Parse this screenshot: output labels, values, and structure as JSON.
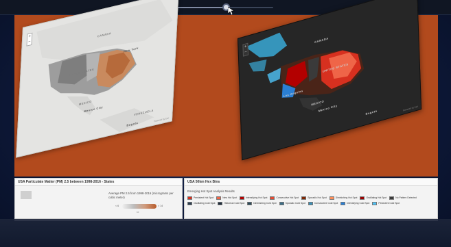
{
  "slider": {
    "value": 0.65
  },
  "left_map": {
    "labels": {
      "canada": "CANADA",
      "united_states": "UNITED STATES",
      "mexico": "MEXICO",
      "mexico_city": "Mexico City",
      "new_york": "New York",
      "venezuela": "VENEZUELA",
      "bogota": "Bogota",
      "attribution": "Powered by Esri"
    },
    "zoom": {
      "plus": "+",
      "minus": "−"
    }
  },
  "right_map": {
    "labels": {
      "canada": "CANADA",
      "united_states": "UNITED STATES",
      "mexico": "MEXICO",
      "mexico_city": "Mexico City",
      "los_angeles": "Los Angeles",
      "bogota": "Bogota",
      "attribution": "Powered by Esri"
    },
    "zoom": {
      "plus": "+",
      "minus": "−"
    }
  },
  "left_panel": {
    "title": "USA Particulate Matter (PM) 2.5 between 1998-2016 - States",
    "legend_text": "Average PM 2.5 from 1998-2016 (micrograms per cubic meter)",
    "ramp_low": "< 6",
    "ramp_high": "> 14",
    "ramp_mid": "10"
  },
  "right_panel": {
    "title": "USA 50km Hex Bins",
    "subhead": "Emerging Hot Spot Analysis Results",
    "items": [
      {
        "label": "Persistent Hot Spot",
        "color": "#d7301f"
      },
      {
        "label": "New Hot Spot",
        "color": "#ef6548"
      },
      {
        "label": "Intensifying Hot Spot",
        "color": "#b30000"
      },
      {
        "label": "Consecutive Hot Spot",
        "color": "#e34a33"
      },
      {
        "label": "Sporadic Hot Spot",
        "color": "#7f2704"
      },
      {
        "label": "Diminishing Hot Spot",
        "color": "#fc8d59"
      },
      {
        "label": "Oscillating Hot Spot",
        "color": "#990000"
      },
      {
        "label": "No Pattern Detected",
        "color": "#3a3a3a"
      },
      {
        "label": "Oscillating Cold Spot",
        "color": "#2c3e50"
      },
      {
        "label": "Historical Cold Spot",
        "color": "#1f2d3d"
      },
      {
        "label": "Diminishing Cold Spot",
        "color": "#2b4a5a"
      },
      {
        "label": "Sporadic Cold Spot",
        "color": "#3b6d86"
      },
      {
        "label": "Consecutive Cold Spot",
        "color": "#3a8fb7"
      },
      {
        "label": "Intensifying Cold Spot",
        "color": "#2a7fd4"
      },
      {
        "label": "Persistent Cold Spot",
        "color": "#4fc3f7"
      }
    ]
  }
}
